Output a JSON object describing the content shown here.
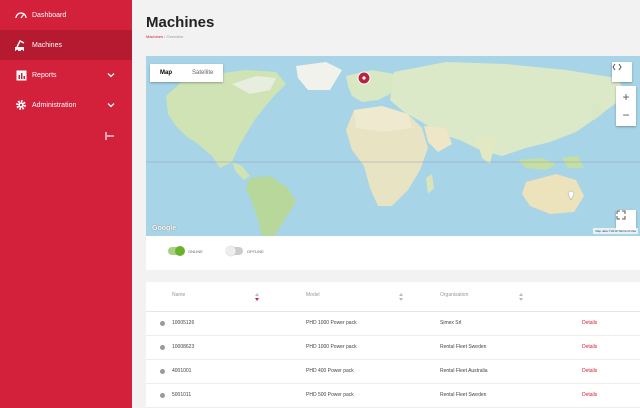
{
  "sidebar": {
    "items": [
      {
        "label": "Dashboard",
        "icon": "gauge-icon"
      },
      {
        "label": "Machines",
        "icon": "machine-icon"
      },
      {
        "label": "Reports",
        "icon": "chart-icon"
      },
      {
        "label": "Administration",
        "icon": "gear-icon"
      }
    ],
    "accent": "#d3203b"
  },
  "header": {
    "title": "Machines",
    "breadcrumb_link": "Machines",
    "breadcrumb_rest": "/ Overview"
  },
  "map": {
    "tabs": [
      {
        "label": "Map"
      },
      {
        "label": "Satellite"
      }
    ],
    "zoom_in": "+",
    "zoom_out": "−",
    "attribution": "Map data ©2019   Terms of Use",
    "logo": "Google"
  },
  "filters": {
    "online_label": "ONLINE",
    "offline_label": "OFFLINE"
  },
  "table": {
    "columns": [
      "Name",
      "Model",
      "Organisation"
    ],
    "rows": [
      {
        "name": "10005126",
        "model": "PHD 1000 Power pack",
        "org": "Simex Srl",
        "action": "Details"
      },
      {
        "name": "10008623",
        "model": "PHD 1000 Power pack",
        "org": "Rental Fleet Sweden",
        "action": "Details"
      },
      {
        "name": "4001001",
        "model": "PHD 400 Power pack",
        "org": "Rental Fleet Australia",
        "action": "Details"
      },
      {
        "name": "5001011",
        "model": "PHD 500 Power pack",
        "org": "Rental Fleet Sweden",
        "action": "Details"
      }
    ]
  }
}
